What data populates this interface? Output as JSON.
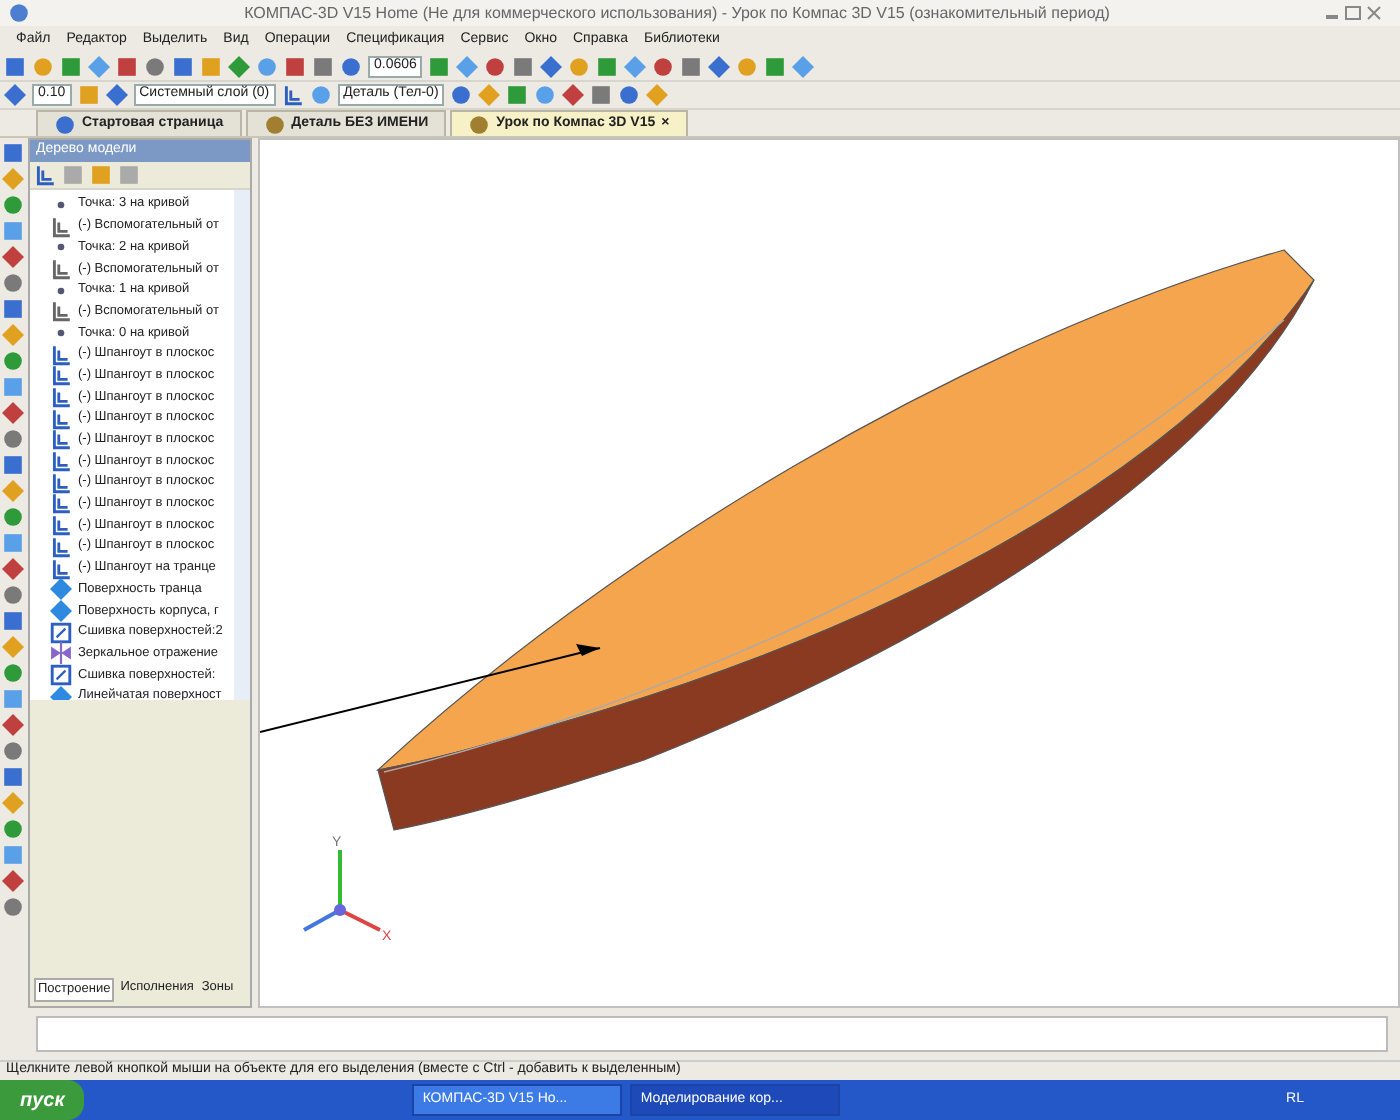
{
  "window": {
    "title": "КОМПАС-3D V15 Home (Не для коммерческого использования) - Урок по Компас 3D V15 (ознакомительный период)"
  },
  "menu": [
    "Файл",
    "Редактор",
    "Выделить",
    "Вид",
    "Операции",
    "Спецификация",
    "Сервис",
    "Окно",
    "Справка",
    "Библиотеки"
  ],
  "toolbar": {
    "scale": "0.0606",
    "step": "0.10",
    "layer": "Системный слой (0)",
    "part": "Деталь (Тел-0)"
  },
  "tabs": [
    {
      "label": "Стартовая страница",
      "selected": false
    },
    {
      "label": "Деталь БЕЗ ИМЕНИ",
      "selected": false
    },
    {
      "label": "Урок по Компас 3D V15",
      "selected": true,
      "close": "×"
    }
  ],
  "tree": {
    "title": "Дерево модели",
    "items": [
      {
        "kind": "point",
        "label": "Точка: 3 на кривой"
      },
      {
        "kind": "aux",
        "label": "(-) Вспомогательный от"
      },
      {
        "kind": "point",
        "label": "Точка: 2 на кривой"
      },
      {
        "kind": "aux",
        "label": "(-) Вспомогательный от"
      },
      {
        "kind": "point",
        "label": "Точка: 1 на кривой"
      },
      {
        "kind": "aux",
        "label": "(-) Вспомогательный от"
      },
      {
        "kind": "point",
        "label": "Точка: 0 на кривой"
      },
      {
        "kind": "frame",
        "label": "(-) Шпангоут в плоскос"
      },
      {
        "kind": "frame",
        "label": "(-) Шпангоут в плоскос"
      },
      {
        "kind": "frame",
        "label": "(-) Шпангоут в плоскос"
      },
      {
        "kind": "frame",
        "label": "(-) Шпангоут в плоскос"
      },
      {
        "kind": "frame",
        "label": "(-) Шпангоут в плоскос"
      },
      {
        "kind": "frame",
        "label": "(-) Шпангоут в плоскос"
      },
      {
        "kind": "frame",
        "label": "(-) Шпангоут в плоскос"
      },
      {
        "kind": "frame",
        "label": "(-) Шпангоут в плоскос"
      },
      {
        "kind": "frame",
        "label": "(-) Шпангоут в плоскос"
      },
      {
        "kind": "frame",
        "label": "(-) Шпангоут в плоскос"
      },
      {
        "kind": "frame",
        "label": "(-) Шпангоут на транце"
      },
      {
        "kind": "surface",
        "label": "Поверхность транца"
      },
      {
        "kind": "surface",
        "label": "Поверхность корпуса, г"
      },
      {
        "kind": "stitch",
        "label": "Сшивка поверхностей:2"
      },
      {
        "kind": "mirror",
        "label": "Зеркальное отражение"
      },
      {
        "kind": "stitch",
        "label": "Сшивка поверхностей:"
      },
      {
        "kind": "surface",
        "label": "Линейчатая поверхност"
      }
    ],
    "bottom_tabs": [
      {
        "label": "Построение",
        "selected": true
      },
      {
        "label": "Исполнения",
        "selected": false
      },
      {
        "label": "Зоны",
        "selected": false
      }
    ]
  },
  "viewport": {
    "axes": [
      "Y",
      "X"
    ]
  },
  "status_bar": "Щелкните левой кнопкой мыши на объекте для его выделения (вместе с Ctrl - добавить к выделенным)",
  "taskbar": {
    "start": "пуск",
    "windows": [
      {
        "label": "КОМПАС-3D V15 Ho...",
        "selected": false
      },
      {
        "label": "Моделирование кор...",
        "selected": true
      }
    ],
    "language": "RL"
  }
}
